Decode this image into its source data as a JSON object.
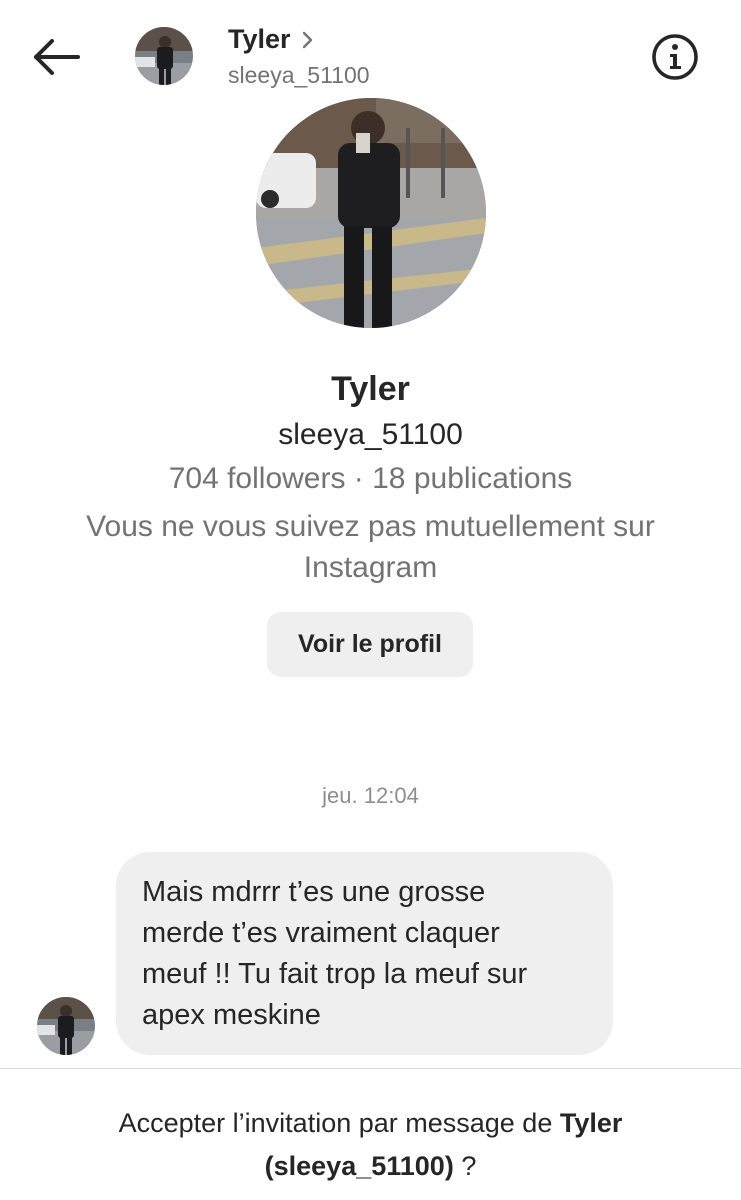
{
  "header": {
    "name": "Tyler",
    "username": "sleeya_51100"
  },
  "profile": {
    "name": "Tyler",
    "username": "sleeya_51100",
    "stats": "704 followers · 18 publications",
    "mutual_line1": "Vous ne vous suivez pas mutuellement sur",
    "mutual_line2": "Instagram",
    "view_profile_label": "Voir le profil"
  },
  "conversation": {
    "timestamp": "jeu. 12:04",
    "messages": [
      {
        "line1": "Mais mdrrr t’es une grosse",
        "line2": "merde t’es vraiment claquer",
        "line3": "meuf !! Tu fait trop la meuf sur",
        "line4": "apex meskine"
      }
    ]
  },
  "invitation": {
    "prefix": "Accepter l’invitation par message de ",
    "name": "Tyler",
    "username_part": "(sleeya_51100)",
    "suffix": " ?"
  },
  "icons": {
    "back": "arrow-left-icon",
    "chevron": "chevron-right-icon",
    "info": "info-icon"
  }
}
